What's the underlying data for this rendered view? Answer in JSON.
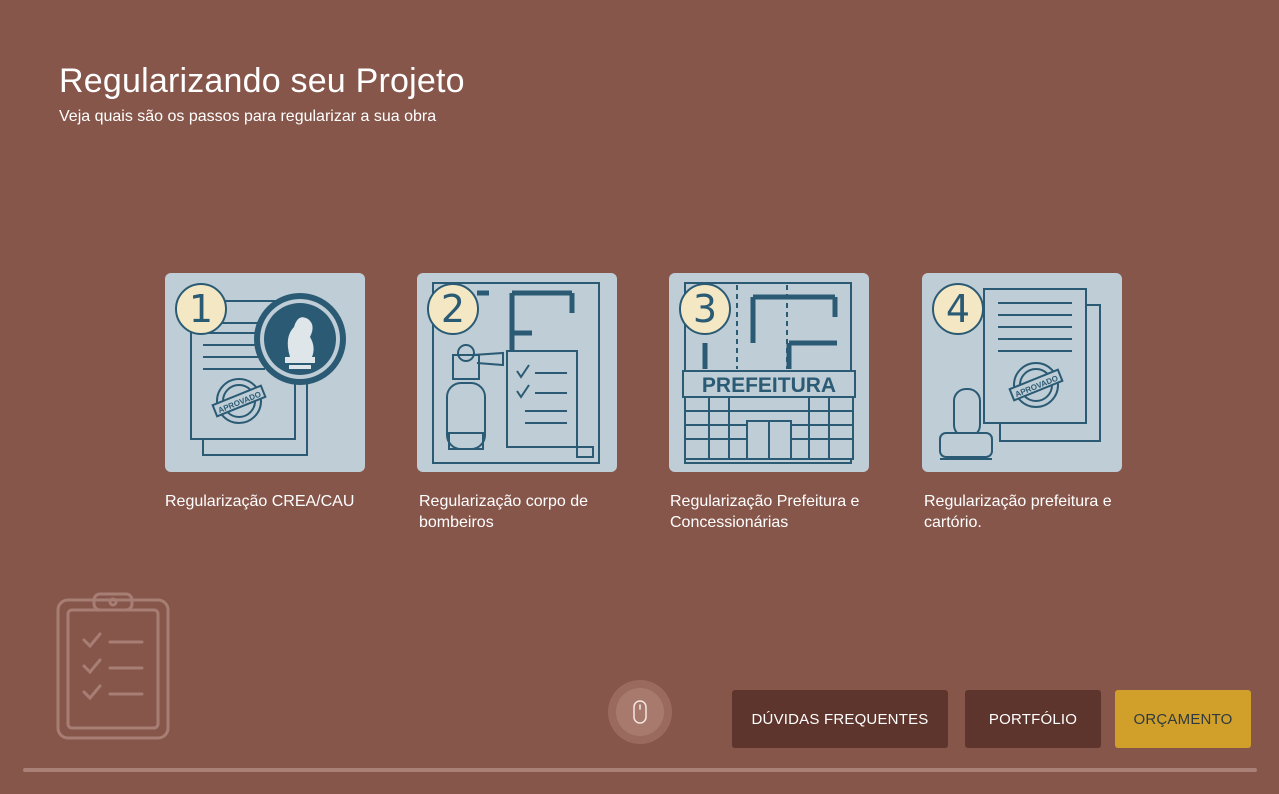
{
  "header": {
    "title": "Regularizando seu Projeto",
    "subtitle": "Veja quais são os passos para regularizar a sua obra"
  },
  "steps": [
    {
      "number": "1",
      "label": "Regularização CREA/CAU",
      "stamp_text": "APROVADO"
    },
    {
      "number": "2",
      "label": "Regularização corpo de bombeiros"
    },
    {
      "number": "3",
      "label": "Regularização Prefeitura e Concessionárias",
      "sign_text": "PREFEITURA"
    },
    {
      "number": "4",
      "label": "Regularização prefeitura e cartório.",
      "stamp_text": "APROVADO"
    }
  ],
  "footer": {
    "faq_label": "DÚVIDAS FREQUENTES",
    "portfolio_label": "PORTFÓLIO",
    "quote_label": "ORÇAMENTO"
  },
  "icons": {
    "clipboard": "clipboard-checklist-icon",
    "scroll": "mouse-scroll-icon"
  },
  "colors": {
    "background": "#87564b",
    "card": "#bfcdd6",
    "ink": "#2b5b74",
    "badge": "#f3e7c4",
    "button_dark": "#5e352d",
    "button_gold": "#d0a02a"
  }
}
